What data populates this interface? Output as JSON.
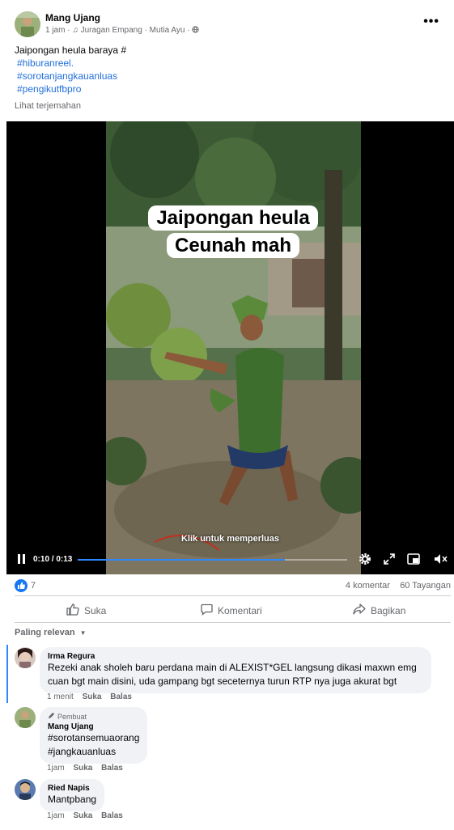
{
  "post": {
    "author": "Mang Ujang",
    "time": "1 jam",
    "music": "Juragan Empang · Mutia Ayu",
    "caption_line": "Jaipongan heula baraya #",
    "hashtags": [
      "#hiburanreel.",
      "#sorotanjangkauanluas",
      "#pengikutfbpro"
    ],
    "translate_link": "Lihat terjemahan"
  },
  "video": {
    "overlay_line1": "Jaipongan heula",
    "overlay_line2": "Ceunah mah",
    "expand_hint": "Klik untuk memperluas",
    "time_display": "0:10 / 0:13",
    "progress": 0.77
  },
  "stats": {
    "reactions": "7",
    "comments": "4 komentar",
    "views": "60 Tayangan"
  },
  "actions": {
    "like": "Suka",
    "comment": "Komentari",
    "share": "Bagikan"
  },
  "sort_label": "Paling relevan",
  "comments": [
    {
      "name": "Irma Regura",
      "text": "Rezeki anak sholeh baru perdana main di ALEXIST*GEL langsung dikasi maxwn emg cuan bgt main disini, uda gampang bgt seceternya turun RTP nya juga akurat bgt",
      "time": "1 menit",
      "like": "Suka",
      "reply": "Balas"
    },
    {
      "tag": "Pembuat",
      "name": "Mang Ujang",
      "text_line1": "#sorotansemuaorang",
      "text_line2": "#jangkauanluas",
      "time": "1jam",
      "like": "Suka",
      "reply": "Balas"
    },
    {
      "name": "Ried Napis",
      "text": "Mantpbang",
      "time": "1jam",
      "like": "Suka",
      "reply": "Balas"
    }
  ],
  "colors": {
    "accent": "#216fdb",
    "progress": "#2d88ff",
    "muted": "#65676b"
  }
}
